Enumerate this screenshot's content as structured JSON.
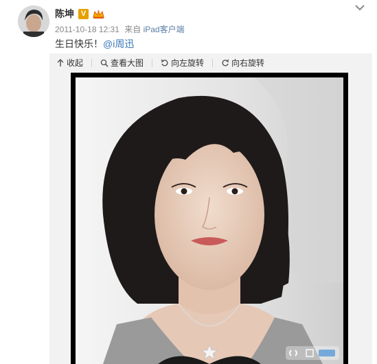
{
  "user": {
    "name": "陈坤",
    "verified_badge": "V",
    "avatar_icon": "avatar-photo"
  },
  "post": {
    "time": "2011-10-18 12:31",
    "source_prefix": "来自",
    "source": "iPad客户端",
    "text": "生日快乐！",
    "mention": "@i周迅"
  },
  "toolbar": {
    "collapse": "收起",
    "view_large": "查看大图",
    "rotate_left": "向左旋转",
    "rotate_right": "向右旋转"
  },
  "icons": {
    "collapse": "arrow-up-icon",
    "view_large": "magnifier-icon",
    "rotate_left": "rotate-left-icon",
    "rotate_right": "rotate-right-icon",
    "menu": "chevron-down-icon",
    "crown": "crown-icon"
  },
  "colors": {
    "link": "#3a78b8",
    "verified": "#e8a000"
  }
}
